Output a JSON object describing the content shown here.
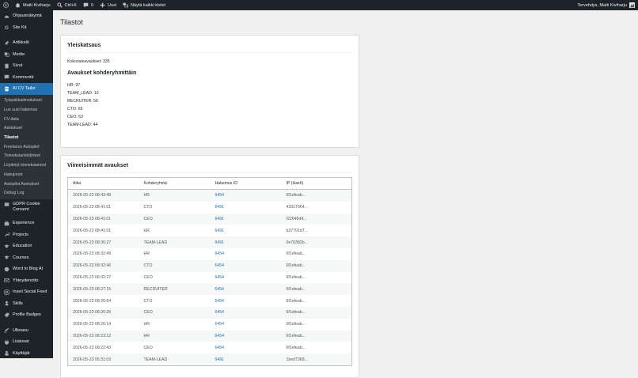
{
  "adminbar": {
    "site_name": "Matti Kiviharju",
    "search_shortcut": "Ctrl+K",
    "comments_count": "0",
    "new_label": "Uusi",
    "languages_label": "Näytä kaikki kielet",
    "greeting": "Tervehdys, Matti Kiviharju"
  },
  "sidebar": {
    "items": [
      {
        "label": "Ohjausnäkymä",
        "icon": "dashboard-icon"
      },
      {
        "label": "Site Kit",
        "icon": "site-kit-icon"
      },
      {
        "label": "Artikkelit",
        "icon": "pin-icon"
      },
      {
        "label": "Media",
        "icon": "media-icon"
      },
      {
        "label": "Sivut",
        "icon": "page-icon"
      },
      {
        "label": "Kommentit",
        "icon": "comment-icon"
      },
      {
        "label": "AI CV Tailor",
        "icon": "document-icon"
      }
    ],
    "submenu": [
      "Työpaikkailmoitukset",
      "Luo uusi hakemus",
      "CV-data",
      "Asetukset",
      "Tilastot",
      "Freelance Autopilot",
      "Toimeksiantolähteet",
      "Löydetyt toimeksiannot",
      "Hakujonot",
      "Autopilot Asetukset",
      "Debug Log"
    ],
    "items_after": [
      {
        "label": "GDPR Cookie Consent",
        "icon": "cookie-icon"
      },
      {
        "label": "Experience",
        "icon": "experience-icon"
      },
      {
        "label": "Projects",
        "icon": "wrench-icon"
      },
      {
        "label": "Education",
        "icon": "education-icon"
      },
      {
        "label": "Courses",
        "icon": "courses-icon"
      },
      {
        "label": "Word to Blog AI",
        "icon": "blog-icon"
      },
      {
        "label": "Yhteydenotto",
        "icon": "contact-icon"
      },
      {
        "label": "Inavii Social Feed",
        "icon": "instagram-icon"
      },
      {
        "label": "Skills",
        "icon": "skills-icon"
      },
      {
        "label": "Profile Badges",
        "icon": "badge-icon"
      },
      {
        "label": "Ulkoasu",
        "icon": "appearance-icon"
      },
      {
        "label": "Lisäosat",
        "icon": "plugin-icon"
      },
      {
        "label": "Käyttäjät",
        "icon": "users-icon"
      }
    ]
  },
  "page": {
    "title": "Tilastot"
  },
  "overview": {
    "title": "Yleiskatsaus",
    "total_label": "Kokonaisavaukset:",
    "total_value": "335",
    "segments_title": "Avaukset kohderyhmittäin",
    "segments": [
      {
        "name": "HR:",
        "value": "97"
      },
      {
        "name": "TEAM_LEAD:",
        "value": "10"
      },
      {
        "name": "RECRUITER:",
        "value": "56"
      },
      {
        "name": "CTO:",
        "value": "65"
      },
      {
        "name": "CEO:",
        "value": "63"
      },
      {
        "name": "TEAM-LEAD:",
        "value": "44"
      }
    ]
  },
  "recent": {
    "title": "Viimeisimmät avaukset",
    "columns": [
      "Aika",
      "Kohderyhmä",
      "Hakemus ID",
      "IP (Hash)"
    ],
    "rows": [
      [
        "2026-05-23 08:43:48",
        "HR",
        "6454",
        "6f1efeab..."
      ],
      [
        "2026-05-23 08:41:01",
        "CTO",
        "6491",
        "43317064..."
      ],
      [
        "2026-05-23 08:41:01",
        "CEO",
        "6491",
        "f22646d4..."
      ],
      [
        "2026-05-23 08:41:01",
        "HR",
        "6491",
        "b37701d7..."
      ],
      [
        "2026-05-23 08:36:27",
        "TEAM-LEAD",
        "6491",
        "0e70382b..."
      ],
      [
        "2026-05-23 08:32:49",
        "HR",
        "6454",
        "6f1efeab..."
      ],
      [
        "2026-05-23 08:32:46",
        "CTO",
        "6454",
        "6f1efeab..."
      ],
      [
        "2026-05-23 08:32:27",
        "CEO",
        "6454",
        "6f1efeab..."
      ],
      [
        "2026-05-23 08:27:15",
        "RECRUITER",
        "6454",
        "6f1efeab..."
      ],
      [
        "2026-05-23 08:26:54",
        "CTO",
        "6454",
        "6f1efeab..."
      ],
      [
        "2026-05-23 08:26:26",
        "CEO",
        "6454",
        "6f1efeab..."
      ],
      [
        "2026-05-23 08:26:14",
        "HR",
        "6454",
        "6f1efeab..."
      ],
      [
        "2026-05-23 08:23:12",
        "HR",
        "6454",
        "6f1efeab..."
      ],
      [
        "2026-05-23 08:22:43",
        "CEO",
        "6454",
        "6f1efeab..."
      ],
      [
        "2026-05-23 05:31:03",
        "TEAM-LEAD",
        "6491",
        "1bed7368..."
      ]
    ]
  },
  "colors": {
    "admin_bg": "#1d2327",
    "accent": "#2271b1",
    "link": "#2271b1",
    "page_bg": "#f0f0f1"
  }
}
